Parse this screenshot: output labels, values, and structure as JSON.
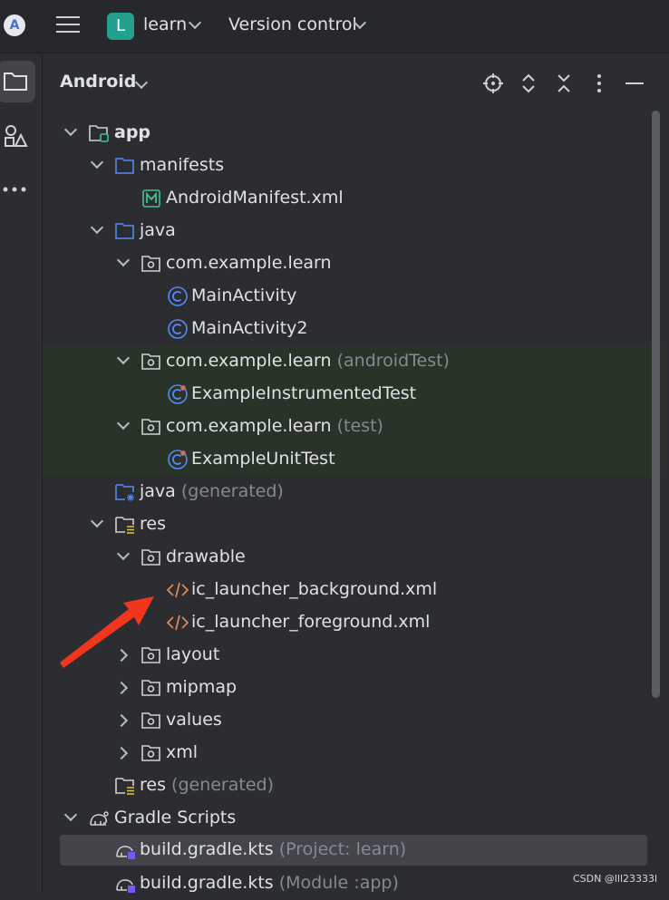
{
  "topbar": {
    "project_badge": "L",
    "project_name": "learn",
    "vcs_label": "Version control"
  },
  "panel": {
    "title": "Android",
    "actions": [
      "locate-icon",
      "expand-all-icon",
      "collapse-all-icon",
      "more-vertical-icon",
      "minimize-icon"
    ]
  },
  "tree": {
    "app": "app",
    "manifests": "manifests",
    "android_manifest": "AndroidManifest.xml",
    "java": "java",
    "pkg_main": "com.example.learn",
    "main_activity": "MainActivity",
    "main_activity2": "MainActivity2",
    "pkg_android_test": "com.example.learn",
    "pkg_android_test_hint": "(androidTest)",
    "instrumented_test": "ExampleInstrumentedTest",
    "pkg_test": "com.example.learn",
    "pkg_test_hint": "(test)",
    "unit_test": "ExampleUnitTest",
    "java_generated": "java",
    "java_generated_hint": "(generated)",
    "res": "res",
    "drawable": "drawable",
    "ic_bg": "ic_launcher_background.xml",
    "ic_fg": "ic_launcher_foreground.xml",
    "layout": "layout",
    "mipmap": "mipmap",
    "values": "values",
    "xml": "xml",
    "res_generated": "res",
    "res_generated_hint": "(generated)",
    "gradle_scripts": "Gradle Scripts",
    "build_project": "build.gradle.kts",
    "build_project_hint": "(Project: learn)",
    "build_module": "build.gradle.kts",
    "build_module_hint": "(Module :app)"
  },
  "colors": {
    "background": "#2b2d30",
    "green_highlight": "#2a3328",
    "selection": "#43454a",
    "folder_blue": "#548af7",
    "xml_orange": "#e08855",
    "annotation_red": "#f2361e"
  },
  "watermark": "CSDN @lll23333l"
}
